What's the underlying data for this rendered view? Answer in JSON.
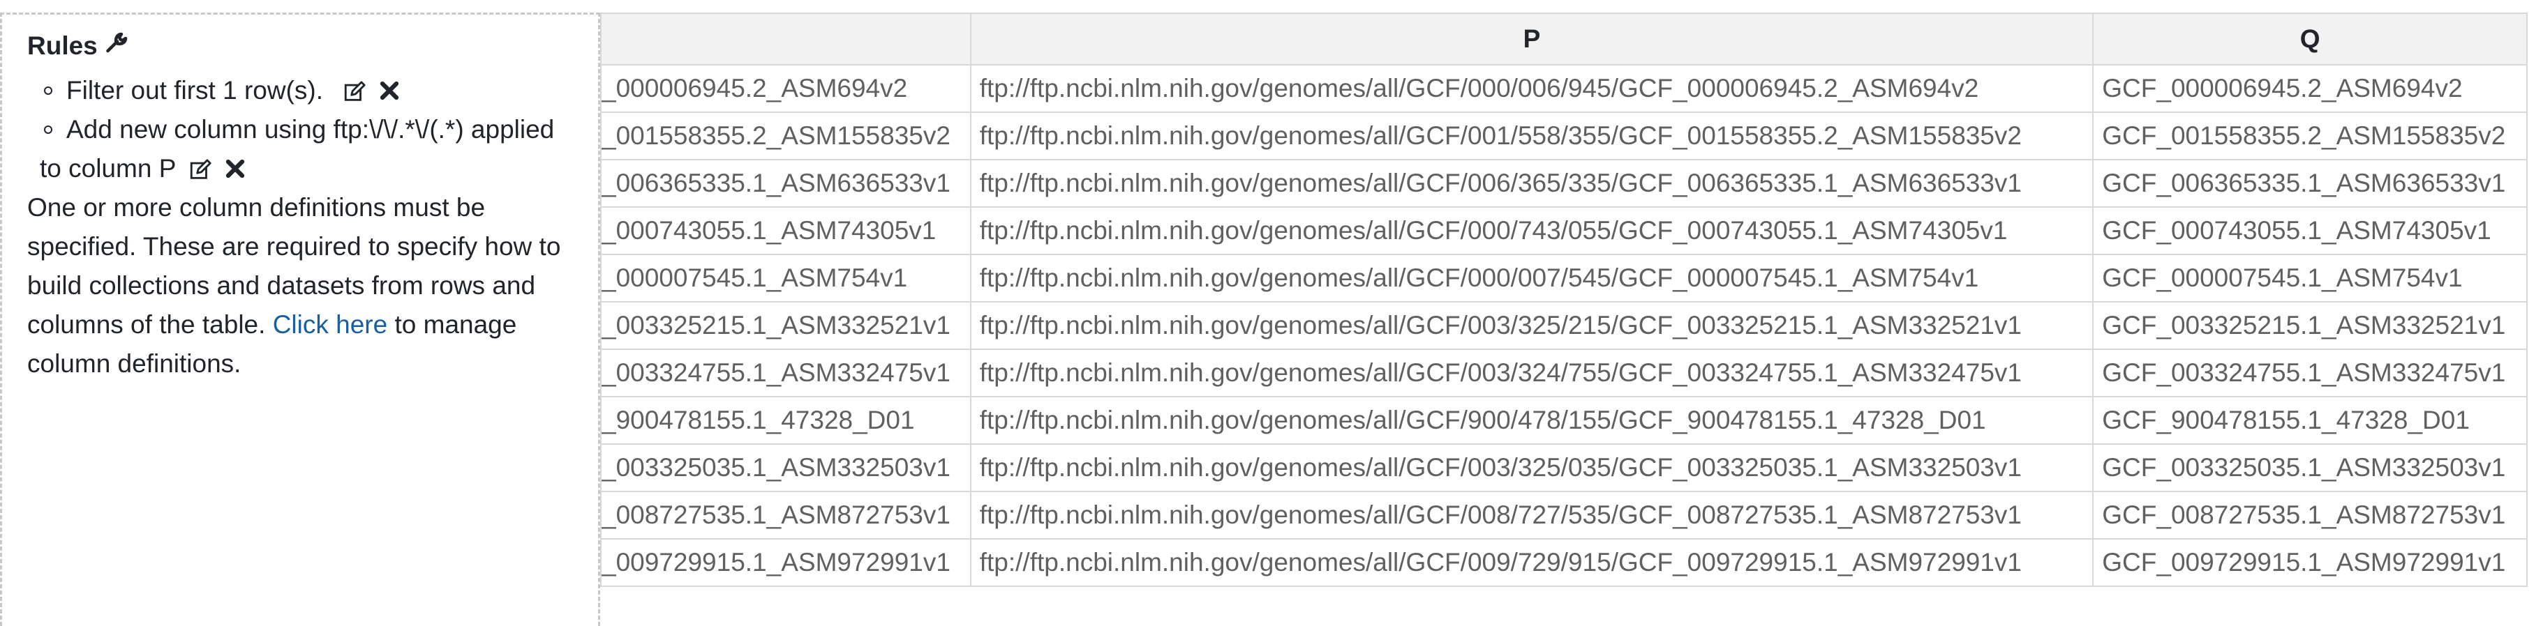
{
  "rules": {
    "title": "Rules",
    "items": [
      {
        "text": "Filter out first 1 row(s)."
      },
      {
        "text": "Add new column using ftp:\\/\\/.*\\/(.*) applied",
        "text_cont": "to column P"
      }
    ],
    "message_before": "One or more column definitions must be specified. These are required to specify how to build collections and datasets from rows and columns of the table.",
    "link_label": "Click here",
    "message_after": "to manage column definitions."
  },
  "table": {
    "headers": [
      "",
      "P",
      "Q"
    ],
    "rows": [
      [
        "_000006945.2_ASM694v2",
        "ftp://ftp.ncbi.nlm.nih.gov/genomes/all/GCF/000/006/945/GCF_000006945.2_ASM694v2",
        "GCF_000006945.2_ASM694v2"
      ],
      [
        "_001558355.2_ASM155835v2",
        "ftp://ftp.ncbi.nlm.nih.gov/genomes/all/GCF/001/558/355/GCF_001558355.2_ASM155835v2",
        "GCF_001558355.2_ASM155835v2"
      ],
      [
        "_006365335.1_ASM636533v1",
        "ftp://ftp.ncbi.nlm.nih.gov/genomes/all/GCF/006/365/335/GCF_006365335.1_ASM636533v1",
        "GCF_006365335.1_ASM636533v1"
      ],
      [
        "_000743055.1_ASM74305v1",
        "ftp://ftp.ncbi.nlm.nih.gov/genomes/all/GCF/000/743/055/GCF_000743055.1_ASM74305v1",
        "GCF_000743055.1_ASM74305v1"
      ],
      [
        "_000007545.1_ASM754v1",
        "ftp://ftp.ncbi.nlm.nih.gov/genomes/all/GCF/000/007/545/GCF_000007545.1_ASM754v1",
        "GCF_000007545.1_ASM754v1"
      ],
      [
        "_003325215.1_ASM332521v1",
        "ftp://ftp.ncbi.nlm.nih.gov/genomes/all/GCF/003/325/215/GCF_003325215.1_ASM332521v1",
        "GCF_003325215.1_ASM332521v1"
      ],
      [
        "_003324755.1_ASM332475v1",
        "ftp://ftp.ncbi.nlm.nih.gov/genomes/all/GCF/003/324/755/GCF_003324755.1_ASM332475v1",
        "GCF_003324755.1_ASM332475v1"
      ],
      [
        "_900478155.1_47328_D01",
        "ftp://ftp.ncbi.nlm.nih.gov/genomes/all/GCF/900/478/155/GCF_900478155.1_47328_D01",
        "GCF_900478155.1_47328_D01"
      ],
      [
        "_003325035.1_ASM332503v1",
        "ftp://ftp.ncbi.nlm.nih.gov/genomes/all/GCF/003/325/035/GCF_003325035.1_ASM332503v1",
        "GCF_003325035.1_ASM332503v1"
      ],
      [
        "_008727535.1_ASM872753v1",
        "ftp://ftp.ncbi.nlm.nih.gov/genomes/all/GCF/008/727/535/GCF_008727535.1_ASM872753v1",
        "GCF_008727535.1_ASM872753v1"
      ],
      [
        "_009729915.1_ASM972991v1",
        "ftp://ftp.ncbi.nlm.nih.gov/genomes/all/GCF/009/729/915/GCF_009729915.1_ASM972991v1",
        "GCF_009729915.1_ASM972991v1"
      ]
    ]
  },
  "icons": {
    "title": "wrench-icon",
    "edit": "edit-icon",
    "remove": "remove-icon"
  },
  "colors": {
    "link": "#1a5fa0",
    "cell_text": "#606060",
    "header_bg": "#f2f2f2",
    "border": "#d8d8d8"
  }
}
